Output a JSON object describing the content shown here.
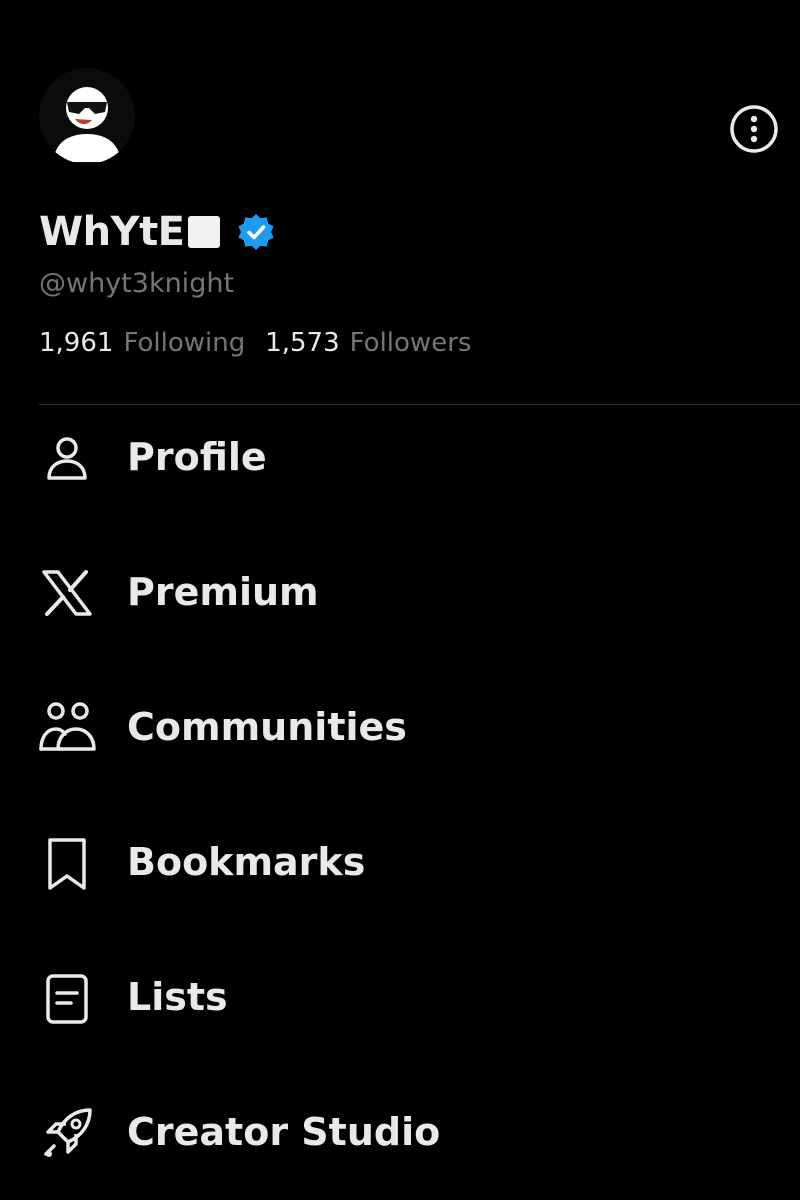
{
  "profile": {
    "display_name": "WhYtE",
    "handle": "@whyt3knight",
    "verified": true,
    "avatar_icon": "avatar-sunglasses-icon",
    "more_icon": "more-options-icon"
  },
  "stats": {
    "following_count": "1,961",
    "following_label": "Following",
    "followers_count": "1,573",
    "followers_label": "Followers"
  },
  "menu": {
    "items": [
      {
        "label": "Profile",
        "icon": "person-icon"
      },
      {
        "label": "Premium",
        "icon": "x-logo-icon"
      },
      {
        "label": "Communities",
        "icon": "communities-icon"
      },
      {
        "label": "Bookmarks",
        "icon": "bookmark-icon"
      },
      {
        "label": "Lists",
        "icon": "list-icon"
      },
      {
        "label": "Creator Studio",
        "icon": "rocket-icon"
      }
    ]
  },
  "colors": {
    "background": "#000000",
    "text_primary": "#e7e9ea",
    "text_secondary": "#71767b",
    "verified_blue": "#1d9bf0",
    "divider": "#2f3336"
  }
}
